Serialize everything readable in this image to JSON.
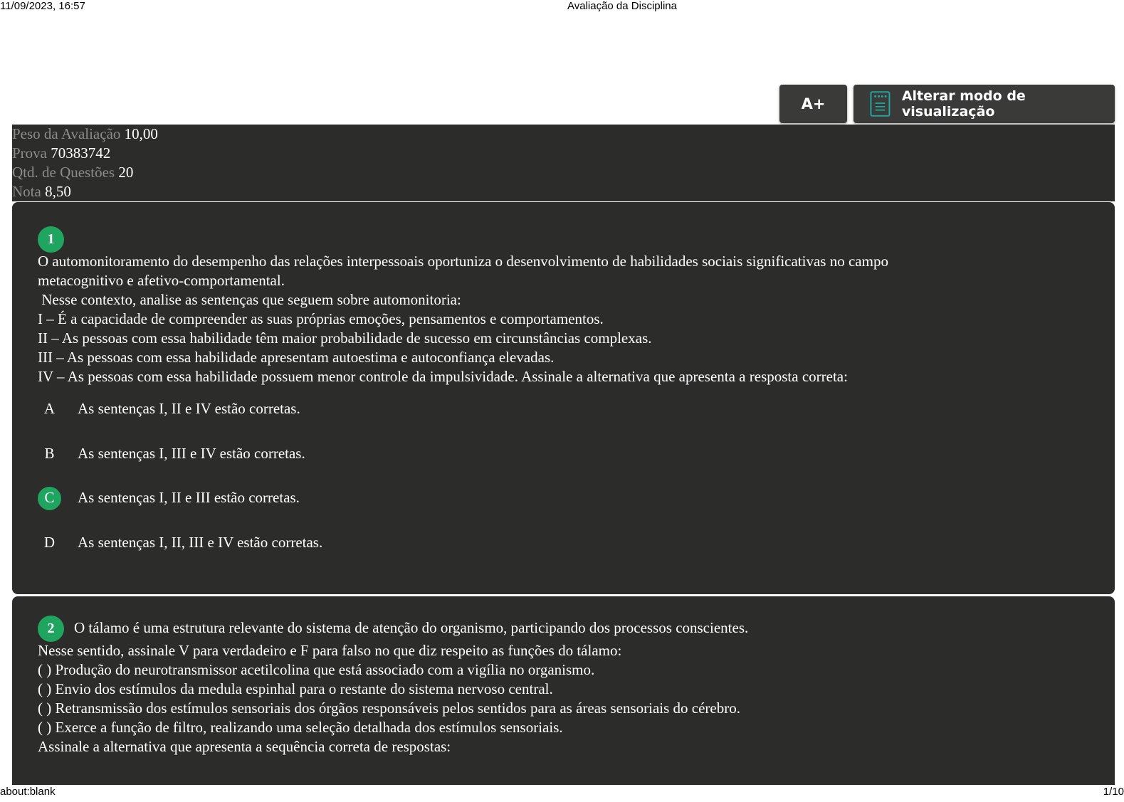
{
  "print_header": {
    "datetime": "11/09/2023, 16:57",
    "title": "Avaliação da Disciplina"
  },
  "print_footer": {
    "url": "about:blank",
    "page": "1/10"
  },
  "toolbar": {
    "font_button_label": "A+",
    "view_mode_label": "Alterar modo de visualização",
    "view_mode_icon": "document-icon"
  },
  "summary": {
    "weight_label": "Peso da Avaliação",
    "weight_value": "10,00",
    "exam_label": "Prova",
    "exam_value": "70383742",
    "questions_label": "Qtd. de Questões",
    "questions_value": "20",
    "grade_label": "Nota",
    "grade_value": "8,50"
  },
  "questions": [
    {
      "number": "1",
      "lines": [
        "O automonitoramento do desempenho das relações interpessoais oportuniza o desenvolvimento de habilidades sociais significativas no campo",
        "metacognitivo e afetivo-comportamental.",
        " Nesse contexto, analise as sentenças que seguem sobre automonitoria:",
        "I – É a capacidade de compreender as suas próprias emoções, pensamentos e comportamentos.",
        "II – As pessoas com essa habilidade têm maior probabilidade de sucesso em circunstâncias complexas.",
        "III – As pessoas com essa habilidade apresentam autoestima e autoconfiança elevadas.",
        "IV – As pessoas com essa habilidade possuem menor controle da impulsividade. Assinale a alternativa que apresenta a resposta correta:"
      ],
      "alternatives": [
        {
          "letter": "A",
          "text": "As sentenças I, II e IV estão corretas."
        },
        {
          "letter": "B",
          "text": "As sentenças I, III e IV estão corretas."
        },
        {
          "letter": "C",
          "text": "As sentenças I, II e III estão corretas."
        },
        {
          "letter": "D",
          "text": "As sentenças I, II, III e IV estão corretas."
        }
      ],
      "correct_color": "#1fa55f"
    },
    {
      "number": "2",
      "lines": [
        "O tálamo é uma estrutura relevante do sistema de atenção do organismo, participando dos processos conscientes.",
        "Nesse sentido, assinale V para verdadeiro e F para falso no que diz respeito as funções do tálamo:",
        "( ) Produção do neurotransmissor acetilcolina que está associado com a vigília no organismo.",
        "( ) Envio dos estímulos da medula espinhal para o restante do sistema nervoso central.",
        "( ) Retransmissão dos estímulos sensoriais dos órgãos responsáveis pelos sentidos para as áreas sensoriais do cérebro.",
        "( ) Exerce a função de filtro, realizando uma seleção detalhada dos estímulos sensoriais.",
        "Assinale a alternativa que apresenta a sequência correta de respostas:"
      ]
    }
  ]
}
